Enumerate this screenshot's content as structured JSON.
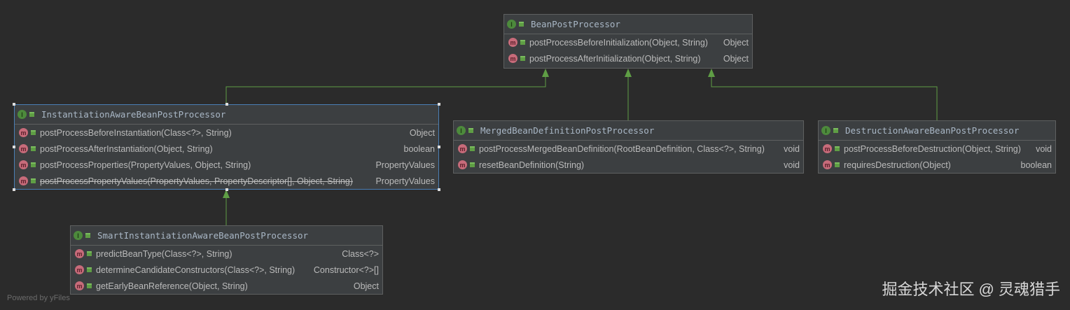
{
  "classes": [
    {
      "id": "bpp",
      "name": "BeanPostProcessor",
      "members": [
        {
          "sig": "postProcessBeforeInitialization(Object, String)",
          "ret": "Object"
        },
        {
          "sig": "postProcessAfterInitialization(Object, String)",
          "ret": "Object"
        }
      ]
    },
    {
      "id": "iabpp",
      "name": "InstantiationAwareBeanPostProcessor",
      "selected": true,
      "members": [
        {
          "sig": "postProcessBeforeInstantiation(Class<?>, String)",
          "ret": "Object"
        },
        {
          "sig": "postProcessAfterInstantiation(Object, String)",
          "ret": "boolean"
        },
        {
          "sig": "postProcessProperties(PropertyValues, Object, String)",
          "ret": "PropertyValues"
        },
        {
          "sig": "postProcessPropertyValues(PropertyValues, PropertyDescriptor[], Object, String)",
          "ret": "PropertyValues",
          "deprecated": true
        }
      ]
    },
    {
      "id": "mbd",
      "name": "MergedBeanDefinitionPostProcessor",
      "members": [
        {
          "sig": "postProcessMergedBeanDefinition(RootBeanDefinition, Class<?>, String)",
          "ret": "void"
        },
        {
          "sig": "resetBeanDefinition(String)",
          "ret": "void"
        }
      ]
    },
    {
      "id": "dabpp",
      "name": "DestructionAwareBeanPostProcessor",
      "members": [
        {
          "sig": "postProcessBeforeDestruction(Object, String)",
          "ret": "void"
        },
        {
          "sig": "requiresDestruction(Object)",
          "ret": "boolean"
        }
      ]
    },
    {
      "id": "sia",
      "name": "SmartInstantiationAwareBeanPostProcessor",
      "members": [
        {
          "sig": "predictBeanType(Class<?>, String)",
          "ret": "Class<?>"
        },
        {
          "sig": "determineCandidateConstructors(Class<?>, String)",
          "ret": "Constructor<?>[]"
        },
        {
          "sig": "getEarlyBeanReference(Object, String)",
          "ret": "Object"
        }
      ]
    }
  ],
  "icons": {
    "interface": "I",
    "method": "m"
  },
  "footer": {
    "powered": "Powered by yFiles",
    "watermark": "掘金技术社区 @ 灵魂猎手"
  },
  "colors": {
    "edge": "#5f9e45",
    "background": "#2b2b2b"
  }
}
